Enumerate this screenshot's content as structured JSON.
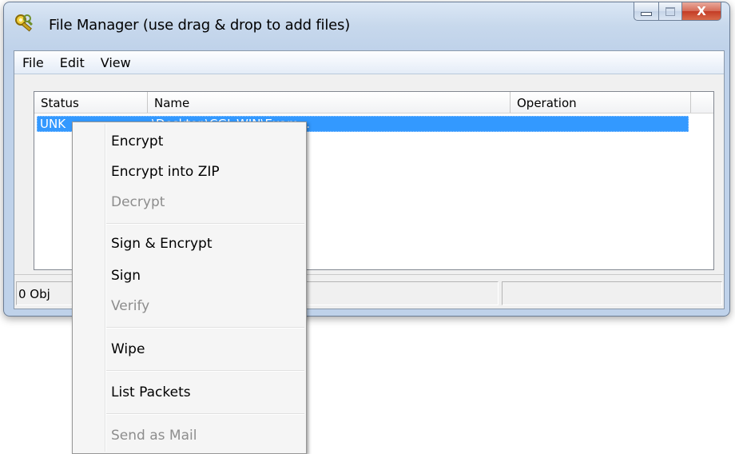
{
  "window": {
    "title": "File Manager (use drag & drop to add files)",
    "close_glyph": "X"
  },
  "menubar": [
    "File",
    "Edit",
    "View"
  ],
  "list": {
    "columns": [
      "Status",
      "Name",
      "Operation"
    ],
    "rows": [
      {
        "status": "UNK",
        "name": "\\Desktop\\CGI_WIN\\Exam...",
        "selected": true
      }
    ]
  },
  "statusbar": {
    "objects": "0 Obj"
  },
  "context_menu": {
    "items": [
      {
        "label": "Encrypt",
        "enabled": true
      },
      {
        "label": "Encrypt into ZIP",
        "enabled": true
      },
      {
        "label": "Decrypt",
        "enabled": false
      },
      {
        "label": "Sign & Encrypt",
        "enabled": true
      },
      {
        "label": "Sign",
        "enabled": true
      },
      {
        "label": "Verify",
        "enabled": false
      },
      {
        "label": "Wipe",
        "enabled": true
      },
      {
        "label": "List Packets",
        "enabled": true
      },
      {
        "label": "Send as Mail",
        "enabled": false
      }
    ]
  },
  "colors": {
    "selection": "#3399ff",
    "disabled_text": "#8d8d8d",
    "close_button": "#c43c26"
  },
  "icons": {
    "app": "keys-magnifier-icon",
    "minimize": "minimize-icon",
    "maximize": "maximize-icon",
    "close": "close-icon"
  }
}
